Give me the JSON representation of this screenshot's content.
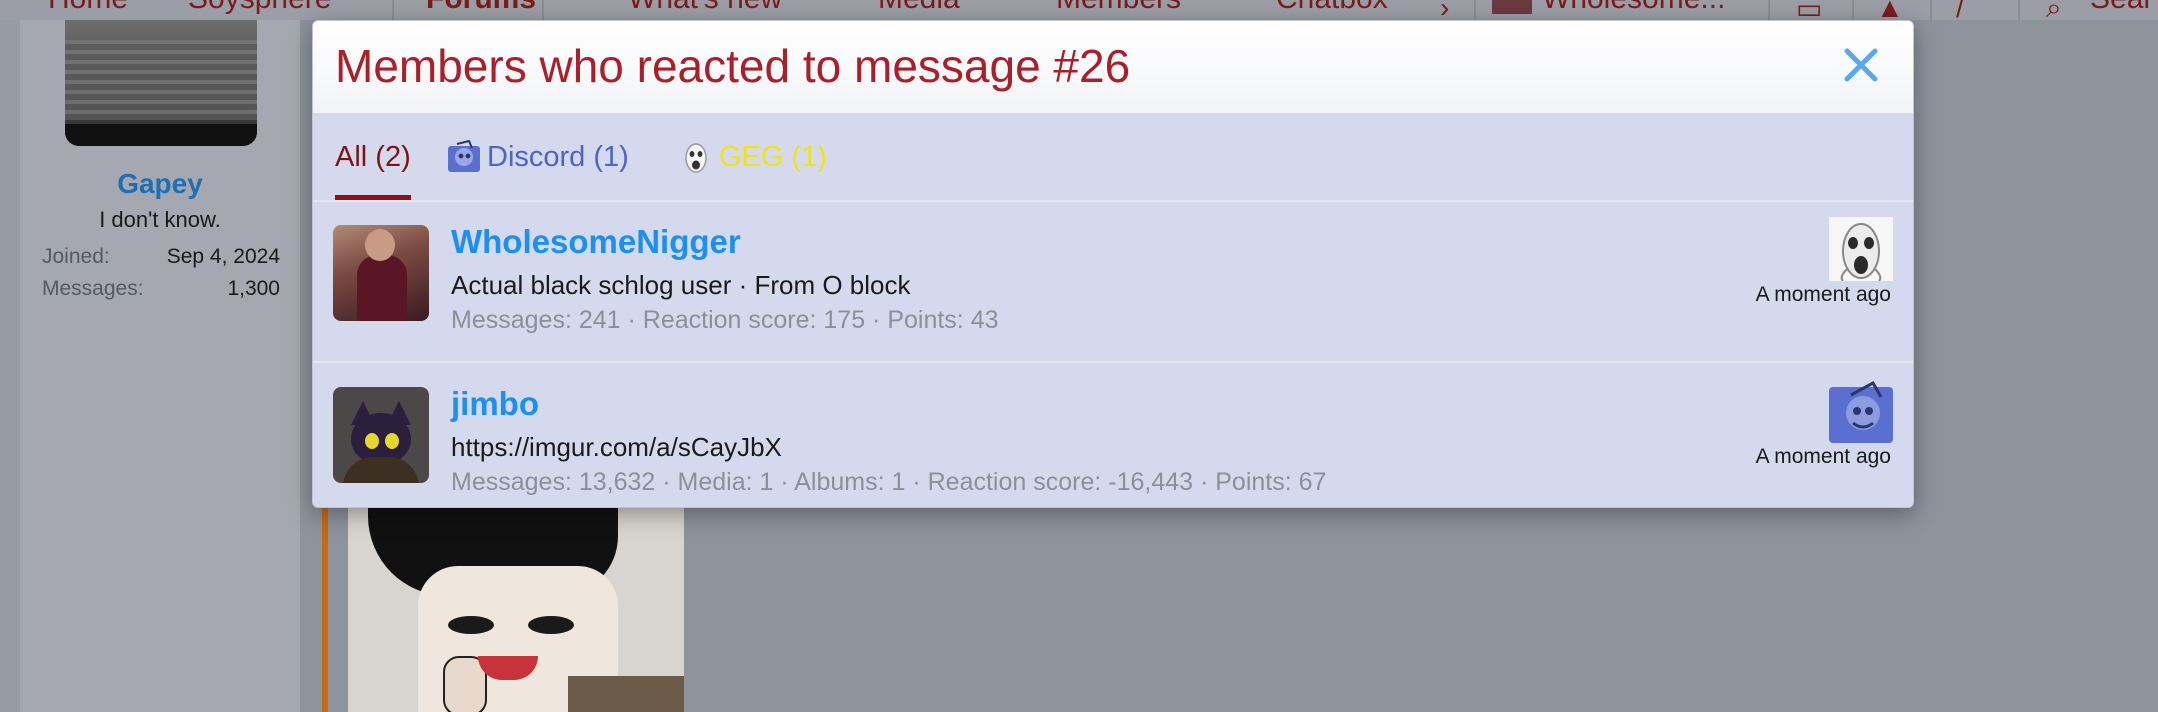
{
  "nav": {
    "items": [
      "Home",
      "Soyspherе",
      "Forums",
      "What's new",
      "Media",
      "Members",
      "Chatbox"
    ],
    "account_label": "Wholesome...",
    "search_label": "Sear"
  },
  "user_panel": {
    "name": "Gapey",
    "title": "I don't know.",
    "joined_label": "Joined:",
    "joined_value": "Sep 4, 2024",
    "messages_label": "Messages:",
    "messages_value": "1,300"
  },
  "modal": {
    "title": "Members who reacted to message #26",
    "close_icon": "close-icon",
    "accent_color": "#a8212a",
    "tabs": [
      {
        "label": "All (2)",
        "icon": null
      },
      {
        "label": "Discord (1)",
        "icon": "discord-reaction-icon"
      },
      {
        "label": "GEG (1)",
        "icon": "geg-reaction-icon"
      }
    ],
    "rows": [
      {
        "username": "WholesomeNigger",
        "blurb": "Actual black schlog user · From O block",
        "stats": "Messages: 241 · Reaction score: 175 · Points: 43",
        "reaction_icon": "geg-reaction-icon",
        "time": "A moment ago"
      },
      {
        "username": "jimbo",
        "blurb": "https://imgur.com/a/sCayJbX",
        "stats": "Messages: 13,632 · Media: 1 · Albums: 1 · Reaction score: -16,443 · Points: 67",
        "reaction_icon": "discord-reaction-icon",
        "time": "A moment ago"
      }
    ]
  }
}
